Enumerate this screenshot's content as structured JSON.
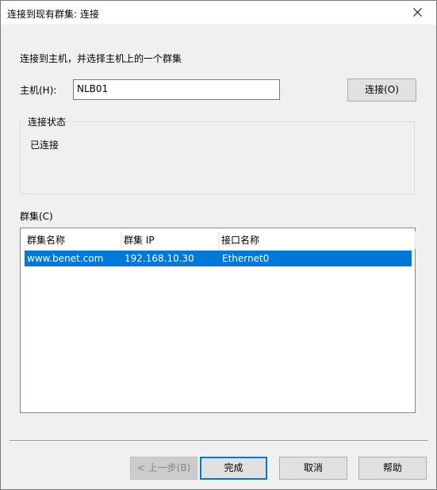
{
  "window": {
    "title": "连接到现有群集: 连接"
  },
  "instruction": "连接到主机，并选择主机上的一个群集",
  "host": {
    "label": "主机(H):",
    "value": "NLB01",
    "connect_label": "连接(O)"
  },
  "connection_status": {
    "legend": "连接状态",
    "value": "已连接"
  },
  "clusters": {
    "label": "群集(C)",
    "columns": [
      "群集名称",
      "群集 IP",
      "接口名称"
    ],
    "rows": [
      [
        "www.benet.com",
        "192.168.10.30",
        "Ethernet0"
      ]
    ],
    "selected_row_color": "#0078d7"
  },
  "buttons": {
    "back": "< 上一步(B)",
    "finish": "完成",
    "cancel": "取消",
    "help": "帮助"
  },
  "icons": {
    "close": "close-icon"
  }
}
